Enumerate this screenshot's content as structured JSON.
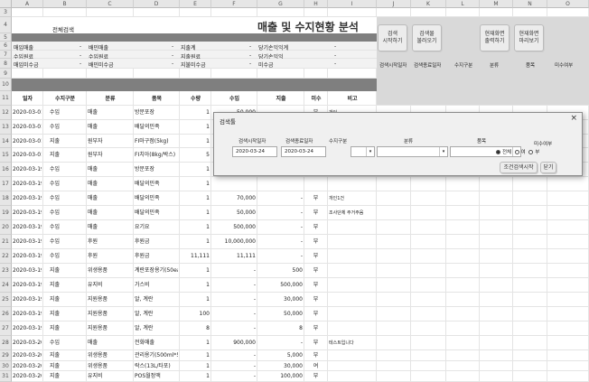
{
  "columns": [
    "A",
    "B",
    "C",
    "D",
    "E",
    "F",
    "G",
    "H",
    "I",
    "J",
    "K",
    "L",
    "M",
    "N",
    "O"
  ],
  "rows": [
    {
      "num": "3"
    },
    {
      "num": "4"
    },
    {
      "num": "5"
    },
    {
      "num": "6"
    },
    {
      "num": "7"
    },
    {
      "num": "8"
    },
    {
      "num": "9"
    },
    {
      "num": "10"
    },
    {
      "num": "11"
    },
    {
      "num": "12"
    },
    {
      "num": "13"
    },
    {
      "num": "14"
    },
    {
      "num": "15"
    },
    {
      "num": "16"
    },
    {
      "num": "17"
    },
    {
      "num": "18"
    },
    {
      "num": "19"
    },
    {
      "num": "20"
    },
    {
      "num": "21"
    },
    {
      "num": "22"
    },
    {
      "num": "23"
    },
    {
      "num": "24"
    },
    {
      "num": "25"
    },
    {
      "num": "26"
    },
    {
      "num": "27"
    },
    {
      "num": "28"
    },
    {
      "num": "29"
    },
    {
      "num": "30"
    },
    {
      "num": "31"
    }
  ],
  "sheet": {
    "search_all_label": "전체검색",
    "title": "매출 및 수지현황 분석",
    "summary": [
      {
        "a": "매입매출",
        "b": "-",
        "c": "배민매출",
        "d": "-",
        "e": "지출계",
        "f": "-",
        "g": "당기손익익계",
        "h": "-"
      },
      {
        "a": "수입원료",
        "b": "-",
        "c": "수입원료",
        "d": "-",
        "e": "지출원료",
        "f": "-",
        "g": "당기손익익",
        "h": "-"
      },
      {
        "a": "매입미수금",
        "b": "-",
        "c": "배민미수금",
        "d": "-",
        "e": "지불미수금",
        "f": "-",
        "g": "미수금",
        "h": "-"
      }
    ],
    "headers": [
      "일자",
      "수지구분",
      "분류",
      "품목",
      "수량",
      "수입",
      "지출",
      "미수",
      "비고"
    ],
    "right_headers": [
      "검색시작일자",
      "검색종료일자",
      "수지구분",
      "분류",
      "품목",
      "미수여부"
    ],
    "data": [
      [
        "2020-03-01",
        "수입",
        "매출",
        "방문포장",
        "1",
        "50,000",
        "",
        "부",
        "개인"
      ],
      [
        "2020-03-01",
        "수입",
        "매출",
        "배달의민족",
        "1",
        "",
        "",
        "",
        ""
      ],
      [
        "2020-03-01",
        "지출",
        "원부자",
        "FI마구점(5kg)",
        "1",
        "",
        "",
        "",
        ""
      ],
      [
        "2020-03-01",
        "지출",
        "원부자",
        "FI치아(8kg/박스)",
        "5",
        "",
        "",
        "",
        ""
      ],
      [
        "2020-03-19",
        "수입",
        "매출",
        "방문포장",
        "1",
        "",
        "",
        "",
        ""
      ],
      [
        "2020-03-19",
        "수입",
        "매출",
        "배달의민족",
        "1",
        "",
        "",
        "",
        ""
      ],
      [
        "2020-03-19",
        "수입",
        "매출",
        "배달의민족",
        "1",
        "70,000",
        "-",
        "부",
        "개인1건"
      ],
      [
        "2020-03-19",
        "수입",
        "매출",
        "배달의민족",
        "1",
        "50,000",
        "-",
        "부",
        "조사단체 주거주음"
      ],
      [
        "2020-03-19",
        "수입",
        "매출",
        "요기요",
        "1",
        "500,000",
        "-",
        "부",
        ""
      ],
      [
        "2020-03-19",
        "수입",
        "후원",
        "후원금",
        "1",
        "10,000,000",
        "-",
        "부",
        ""
      ],
      [
        "2020-03-19",
        "수입",
        "후원",
        "후원금",
        "11,111",
        "11,111",
        "-",
        "부",
        ""
      ],
      [
        "2020-03-19",
        "지출",
        "위생용품",
        "계란포장용기(50ea)",
        "1",
        "-",
        "500",
        "부",
        ""
      ],
      [
        "2020-03-19",
        "지출",
        "유지비",
        "가스비",
        "1",
        "-",
        "500,000",
        "부",
        ""
      ],
      [
        "2020-03-19",
        "지출",
        "지원용품",
        "알, 계란",
        "1",
        "-",
        "30,000",
        "부",
        ""
      ],
      [
        "2020-03-19",
        "지출",
        "지원용품",
        "알, 계란",
        "100",
        "-",
        "50,000",
        "부",
        ""
      ],
      [
        "2020-03-19",
        "지출",
        "지원용품",
        "알, 계란",
        "8",
        "-",
        "8",
        "부",
        ""
      ],
      [
        "2020-03-20",
        "수입",
        "매출",
        "전화매출",
        "1",
        "900,000",
        "-",
        "부",
        "테스트입니다"
      ],
      [
        "2020-03-20",
        "지출",
        "위생용품",
        "관리용기(500ml*50)",
        "1",
        "-",
        "5,000",
        "부",
        ""
      ],
      [
        "2020-03-20",
        "지출",
        "위생용품",
        "락스(13L/타포)",
        "1",
        "-",
        "30,000",
        "여",
        ""
      ],
      [
        "2020-03-20",
        "지출",
        "유지비",
        "POS월정액",
        "1",
        "-",
        "100,000",
        "부",
        ""
      ],
      [
        "2020-03-20",
        "지출",
        "",
        "",
        "",
        "",
        "",
        "",
        ""
      ]
    ],
    "buttons": {
      "search_start": "검색\n시작하기",
      "search_reload": "검색물\n불러오기",
      "print_current": "현재화면\n출력하기",
      "hide_current": "현재화면\n마리보기"
    }
  },
  "dialog": {
    "title": "검색툴",
    "close": "×",
    "labels": {
      "start_date": "검색시작일자",
      "end_date": "검색종료일자",
      "type": "수지구분",
      "category": "분류",
      "item": "품목",
      "unpaid": "미수여부"
    },
    "values": {
      "start_date": "2020-03-24",
      "end_date": "2020-03-24",
      "type": "",
      "category": "",
      "item": ""
    },
    "radio": {
      "all": "전체",
      "yes": "여",
      "no": "부",
      "selected": "all"
    },
    "buttons": {
      "condition_search": "조건검색시작",
      "close": "닫기"
    }
  }
}
